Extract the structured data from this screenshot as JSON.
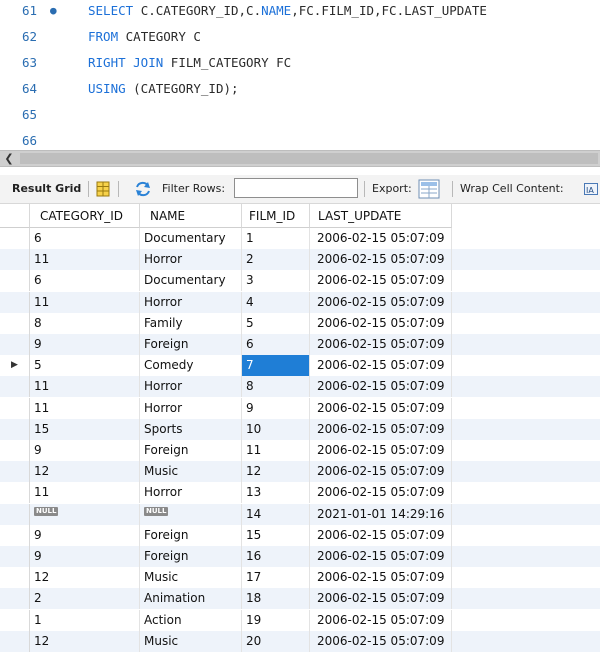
{
  "editor": {
    "lines": [
      {
        "num": "61",
        "dot": "●",
        "tokens": [
          {
            "t": "SELECT ",
            "k": "kw"
          },
          {
            "t": "C.CATEGORY_ID,C.",
            "k": ""
          },
          {
            "t": "NAME",
            "k": "fn"
          },
          {
            "t": ",FC.FILM_ID,FC.LAST_UPDATE",
            "k": ""
          }
        ]
      },
      {
        "num": "62",
        "dot": "",
        "tokens": [
          {
            "t": "FROM ",
            "k": "kw"
          },
          {
            "t": "CATEGORY C",
            "k": ""
          }
        ]
      },
      {
        "num": "63",
        "dot": "",
        "tokens": [
          {
            "t": "RIGHT JOIN ",
            "k": "kw"
          },
          {
            "t": "FILM_CATEGORY FC",
            "k": ""
          }
        ]
      },
      {
        "num": "64",
        "dot": "",
        "tokens": [
          {
            "t": "USING ",
            "k": "kw"
          },
          {
            "t": "(CATEGORY_ID);",
            "k": ""
          }
        ]
      },
      {
        "num": "65",
        "dot": "",
        "tokens": []
      },
      {
        "num": "66",
        "dot": "",
        "tokens": []
      }
    ]
  },
  "toolbar": {
    "result_grid": "Result Grid",
    "filter_rows": "Filter Rows:",
    "filter_value": "",
    "export": "Export:",
    "wrap": "Wrap Cell Content:"
  },
  "grid": {
    "columns": [
      "CATEGORY_ID",
      "NAME",
      "FILM_ID",
      "LAST_UPDATE"
    ],
    "rows": [
      [
        "6",
        "Documentary",
        "1",
        "2006-02-15 05:07:09"
      ],
      [
        "11",
        "Horror",
        "2",
        "2006-02-15 05:07:09"
      ],
      [
        "6",
        "Documentary",
        "3",
        "2006-02-15 05:07:09"
      ],
      [
        "11",
        "Horror",
        "4",
        "2006-02-15 05:07:09"
      ],
      [
        "8",
        "Family",
        "5",
        "2006-02-15 05:07:09"
      ],
      [
        "9",
        "Foreign",
        "6",
        "2006-02-15 05:07:09"
      ],
      [
        "5",
        "Comedy",
        "7",
        "2006-02-15 05:07:09"
      ],
      [
        "11",
        "Horror",
        "8",
        "2006-02-15 05:07:09"
      ],
      [
        "11",
        "Horror",
        "9",
        "2006-02-15 05:07:09"
      ],
      [
        "15",
        "Sports",
        "10",
        "2006-02-15 05:07:09"
      ],
      [
        "9",
        "Foreign",
        "11",
        "2006-02-15 05:07:09"
      ],
      [
        "12",
        "Music",
        "12",
        "2006-02-15 05:07:09"
      ],
      [
        "11",
        "Horror",
        "13",
        "2006-02-15 05:07:09"
      ],
      [
        "NULL",
        "NULL",
        "14",
        "2021-01-01 14:29:16"
      ],
      [
        "9",
        "Foreign",
        "15",
        "2006-02-15 05:07:09"
      ],
      [
        "9",
        "Foreign",
        "16",
        "2006-02-15 05:07:09"
      ],
      [
        "12",
        "Music",
        "17",
        "2006-02-15 05:07:09"
      ],
      [
        "2",
        "Animation",
        "18",
        "2006-02-15 05:07:09"
      ],
      [
        "1",
        "Action",
        "19",
        "2006-02-15 05:07:09"
      ],
      [
        "12",
        "Music",
        "20",
        "2006-02-15 05:07:09"
      ]
    ],
    "current_row_index": 6,
    "selected_cell": {
      "row": 6,
      "col": 2
    },
    "row_marker": "▶"
  },
  "icons": {
    "scroll_left": "chevron-left-icon",
    "result_grid": "grid-icon",
    "refresh": "refresh-icon",
    "export": "export-icon",
    "wrap": "wrap-icon"
  },
  "colors": {
    "keyword": "#1c70d8",
    "selection": "#1f7ed6",
    "alt_row": "#eef3fa"
  }
}
